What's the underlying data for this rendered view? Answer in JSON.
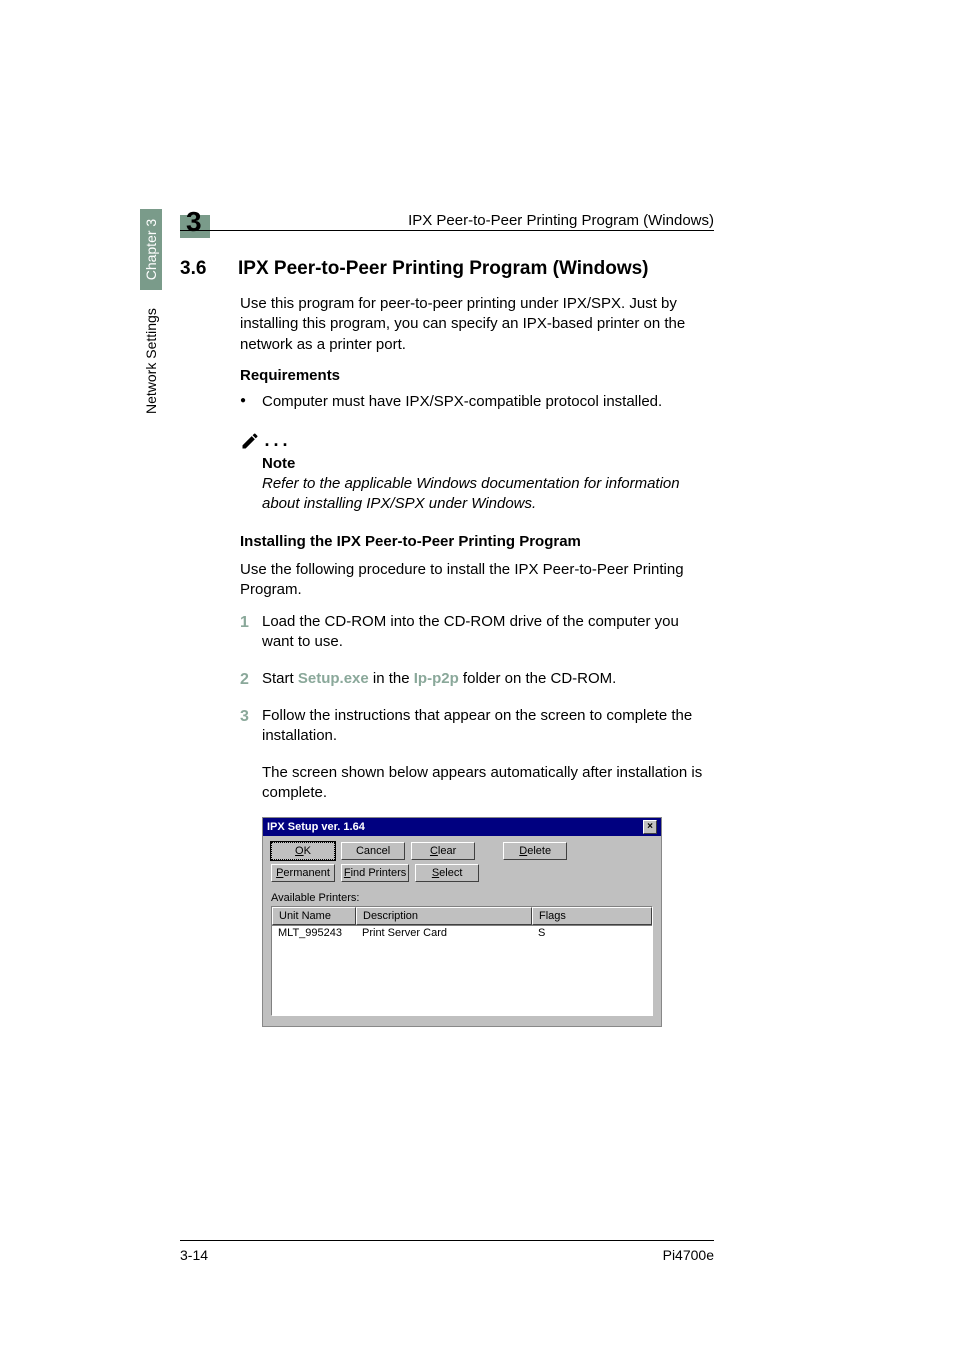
{
  "header": {
    "running_title": "IPX Peer-to-Peer Printing Program (Windows)",
    "chapter_number": "3"
  },
  "sidebar": {
    "section_label": "Network Settings",
    "chapter_label": "Chapter 3"
  },
  "section": {
    "number": "3.6",
    "title": "IPX Peer-to-Peer Printing Program (Windows)",
    "intro": "Use this program for peer-to-peer printing under IPX/SPX. Just by installing this program, you can specify an IPX-based printer on the network as a printer port.",
    "requirements_heading": "Requirements",
    "requirement_bullet": "Computer must have IPX/SPX-compatible protocol installed.",
    "note_label": "Note",
    "note_body": "Refer to the applicable Windows documentation for information about installing IPX/SPX under Windows.",
    "install_heading": "Installing the IPX Peer-to-Peer Printing Program",
    "install_intro": "Use the following procedure to install the IPX Peer-to-Peer Printing Program.",
    "steps": {
      "s1_num": "1",
      "s1": "Load the CD-ROM into the CD-ROM drive of the computer you want to use.",
      "s2_num": "2",
      "s2_a": "Start ",
      "s2_kw1": "Setup.exe",
      "s2_b": " in the ",
      "s2_kw2": "Ip-p2p",
      "s2_c": " folder on the CD-ROM.",
      "s3_num": "3",
      "s3": "Follow the instructions that appear on the screen to complete the installation.",
      "s3_followup": "The screen shown below appears automatically after installation is complete."
    }
  },
  "dialog": {
    "title": "IPX Setup ver. 1.64",
    "buttons": {
      "ok": "OK",
      "cancel": "Cancel",
      "clear": "Clear",
      "delete": "Delete",
      "permanent": "Permanent",
      "find": "Find Printers",
      "select": "Select"
    },
    "list_label": "Available Printers:",
    "columns": {
      "unit": "Unit Name",
      "desc": "Description",
      "flags": "Flags"
    },
    "row": {
      "unit": "MLT_995243",
      "desc": "Print Server Card",
      "flags": "S"
    }
  },
  "footer": {
    "left": "3-14",
    "right": "Pi4700e"
  }
}
